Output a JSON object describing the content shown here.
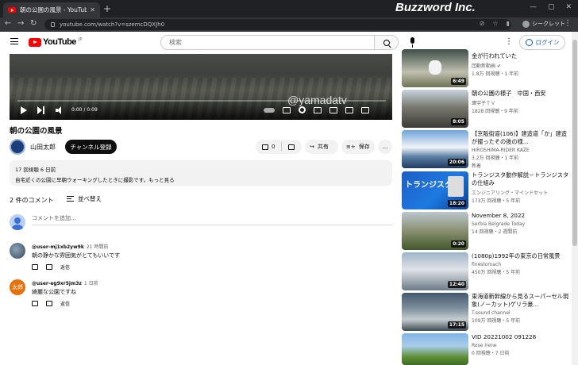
{
  "browser": {
    "tab_title": "朝の公園の風景 - YouTube",
    "url": "youtube.com/watch?v=szemcDQXJh0",
    "profile_label": "シークレット",
    "brand_overlay": "Buzzword Inc."
  },
  "header": {
    "logo_text": "YouTube",
    "logo_suffix": "JP",
    "search_placeholder": "検索",
    "login_label": "ログイン"
  },
  "player": {
    "watermark": "@yamadatv",
    "time": "0:00 / 0:09",
    "progress": 0
  },
  "video": {
    "title": "朝の公園の風景",
    "channel": "山田太郎",
    "subscribe_label": "チャンネル登録",
    "like_count": "0",
    "share_label": "共有",
    "save_label": "保存",
    "more_label": "…",
    "description_meta": "17 回視聴  6 日前",
    "description_text": "自宅近くの公園に早朝ウォーキングしたときに撮影です。もっと見る"
  },
  "comments": {
    "count_label": "2 件のコメント",
    "sort_label": "並べ替え",
    "add_placeholder": "コメントを追加...",
    "reply_label": "返信",
    "items": [
      {
        "author": "@user-mj1xb2yw9k",
        "ago": "21 時間前",
        "text": "朝の静かな雰囲気がとてもいいです",
        "avatar_text": ""
      },
      {
        "author": "@user-eg9xr5jm3z",
        "ago": "1 日前",
        "text": "綺麗な公園ですね",
        "avatar_text": "太郎"
      }
    ]
  },
  "sidebar": {
    "items": [
      {
        "title": "金が行われていた",
        "channel": "団動新動画 ✔",
        "stats": "1.8万 回視聴・1 年前",
        "duration": "6:49"
      },
      {
        "title": "朝の公園の様子　中国・西安",
        "channel": "瑋宇子ＴＶ",
        "stats": "1828 回視聴・9 年前",
        "duration": "8:05"
      },
      {
        "title": "【京阪街道(106)】建造道「か」建造が撮ったその後の様...",
        "channel": "HIROSHIMA-RIDER KAZE",
        "stats": "3.2万 回視聴・1 年前",
        "duration": "20:06",
        "badge": "新着"
      },
      {
        "title": "トランジスタ動作解説－トランジスタの仕組み",
        "channel": "エンジニアリング・マインドセット",
        "stats": "173万 回視聴・5 年前",
        "duration": "18:20",
        "thumb_text": "トランジスタ"
      },
      {
        "title": "November 8, 2022",
        "channel": "Serbia Belgrade Today",
        "stats": "14 回視聴・2 週間前",
        "duration": "0:20"
      },
      {
        "title": "(1080p)1992年の東京の日常風景",
        "channel": "finestomach",
        "stats": "450万 回視聴・5 年前",
        "duration": "12:40"
      },
      {
        "title": "東海道新幹線から見るスーパーセル現象(ノーカット)ゲリラ豪...",
        "channel": "T.sound channel",
        "stats": "109万 回視聴・5 年前",
        "duration": "17:15"
      },
      {
        "title": "VID 20221002 091228",
        "channel": "Rose Irene",
        "stats": "0 回視聴・7 日前",
        "duration": ""
      }
    ]
  }
}
